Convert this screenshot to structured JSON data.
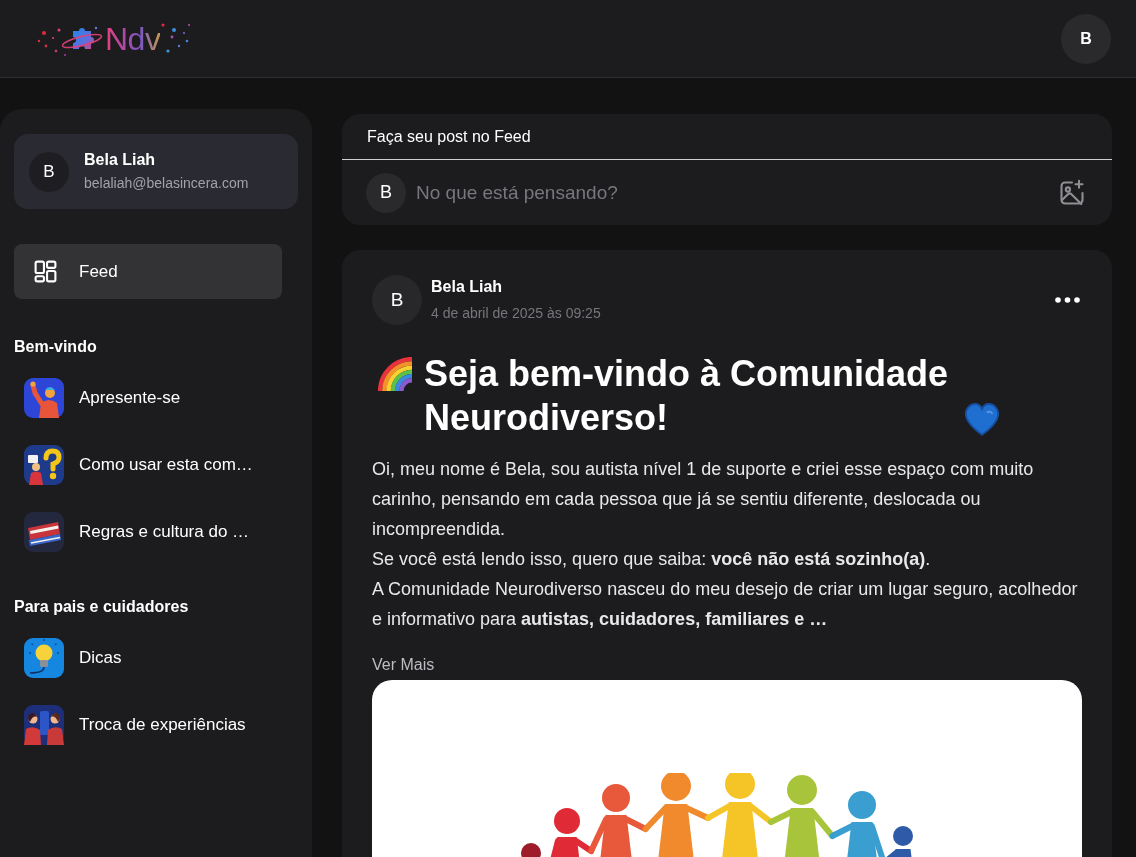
{
  "header": {
    "logo_text": "Ndv",
    "avatar": "B"
  },
  "sidebar": {
    "profile": {
      "avatar": "B",
      "name": "Bela Liah",
      "email": "belaliah@belasincera.com"
    },
    "nav": [
      {
        "label": "Feed",
        "selected": true
      }
    ],
    "sections": [
      {
        "title": "Bem-vindo",
        "items": [
          {
            "label": "Apresente-se",
            "selected": false
          },
          {
            "label": "Como usar esta com…",
            "selected": false
          },
          {
            "label": "Regras e cultura do …",
            "selected": false
          }
        ]
      },
      {
        "title": "Para pais e cuidadores",
        "items": [
          {
            "label": "Dicas",
            "selected": false
          },
          {
            "label": "Troca de experiências",
            "selected": false
          }
        ]
      }
    ]
  },
  "composer": {
    "title": "Faça seu post no Feed",
    "avatar": "B",
    "placeholder": "No que está pensando?"
  },
  "post": {
    "avatar": "B",
    "author": "Bela Liah",
    "date": "4 de abril de 2025 às 09:25",
    "title": "Seja bem-vindo à Comunidade Neurodiverso!",
    "body": [
      "Oi, meu nome é Bela, sou autista nível 1 de suporte e criei esse espaço com muito carinho, pensando em cada pessoa que já se sentiu diferente, deslocada ou incompreendida.",
      "Se você está lendo isso, quero que saiba: **você não está sozinho(a)**.",
      "A Comunidade Neurodiverso nasceu do meu desejo de criar um lugar seguro, acolhedor e informativo para **autistas, cuidadores, familiares e …**"
    ],
    "more_link": "Ver Mais"
  }
}
